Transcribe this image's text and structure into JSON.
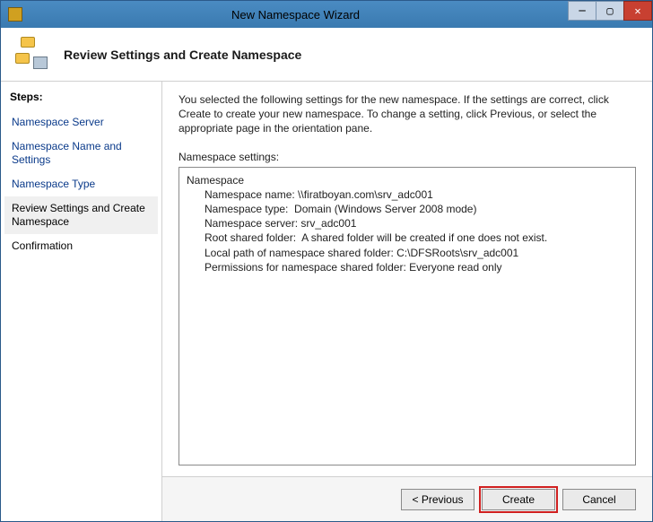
{
  "window": {
    "title": "New Namespace Wizard"
  },
  "header": {
    "title": "Review Settings and Create Namespace"
  },
  "sidebar": {
    "steps_label": "Steps:",
    "items": [
      {
        "label": "Namespace Server"
      },
      {
        "label": "Namespace Name and Settings"
      },
      {
        "label": "Namespace Type"
      },
      {
        "label": "Review Settings and Create Namespace"
      },
      {
        "label": "Confirmation"
      }
    ]
  },
  "main": {
    "intro": "You selected the following settings for the new namespace. If the settings are correct, click Create to create your new namespace. To change a setting, click Previous, or select the appropriate page in the orientation pane.",
    "settings_label": "Namespace settings:",
    "settings_text": "Namespace\n      Namespace name: \\\\firatboyan.com\\srv_adc001\n      Namespace type:  Domain (Windows Server 2008 mode)\n      Namespace server: srv_adc001\n      Root shared folder:  A shared folder will be created if one does not exist.\n      Local path of namespace shared folder: C:\\DFSRoots\\srv_adc001\n      Permissions for namespace shared folder: Everyone read only"
  },
  "buttons": {
    "previous": "< Previous",
    "create": "Create",
    "cancel": "Cancel"
  }
}
